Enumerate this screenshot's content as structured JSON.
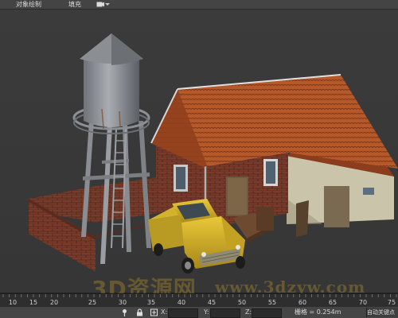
{
  "menu": {
    "object_paint": "对象绘制",
    "populate": "填充",
    "camera_icon": "camera-icon",
    "dropdown_icon": "dropdown-arrow-icon"
  },
  "viewport": {
    "scene_objects": [
      "water-tower",
      "brick-house",
      "yellow-pickup-truck",
      "brick-wall"
    ],
    "watermark": {
      "text": "3D资源网",
      "url": "www.3dzyw.com"
    }
  },
  "timeline": {
    "ticks": [
      "10",
      "15",
      "20",
      "25",
      "30",
      "35",
      "40",
      "45",
      "50",
      "55",
      "60",
      "65",
      "70",
      "75"
    ]
  },
  "statusbar": {
    "x_label": "X:",
    "y_label": "Y:",
    "z_label": "Z:",
    "x_value": "",
    "y_value": "",
    "z_value": "",
    "grid": "栅格 = 0.254m",
    "autokey": "自动关键点"
  },
  "colors": {
    "roof": "#b4582a",
    "brick": "#7a3a2a",
    "truck": "#d8b52a",
    "tower_metal": "#8a8e93",
    "watermark": "#e1b428"
  }
}
